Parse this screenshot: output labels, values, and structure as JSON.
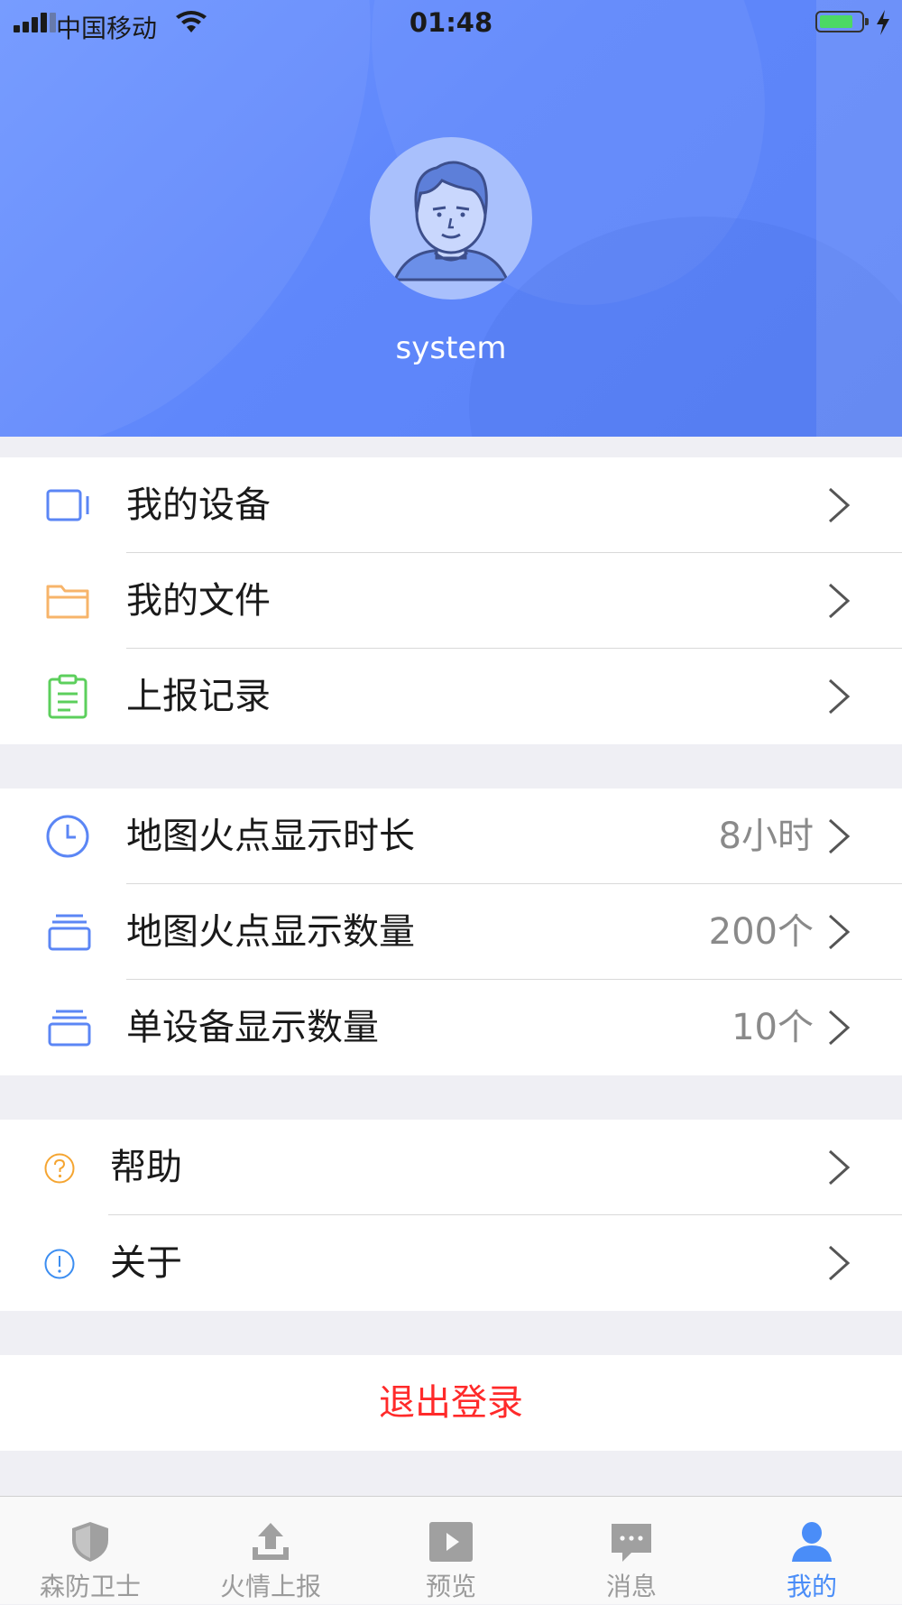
{
  "status_bar": {
    "carrier": "中国移动",
    "time": "01:48"
  },
  "profile": {
    "username": "system"
  },
  "groups": [
    {
      "items": [
        {
          "label": "我的设备",
          "icon": "device-icon",
          "color": "#5b86f5"
        },
        {
          "label": "我的文件",
          "icon": "folder-icon",
          "color": "#f7b46a"
        },
        {
          "label": "上报记录",
          "icon": "clipboard-icon",
          "color": "#5ccf5c"
        }
      ]
    },
    {
      "items": [
        {
          "label": "地图火点显示时长",
          "value": "8小时",
          "icon": "clock-icon",
          "color": "#5b86f5"
        },
        {
          "label": "地图火点显示数量",
          "value": "200个",
          "icon": "stack-icon",
          "color": "#5b86f5"
        },
        {
          "label": "单设备显示数量",
          "value": "10个",
          "icon": "stack-icon",
          "color": "#5b86f5"
        }
      ]
    },
    {
      "items": [
        {
          "label": "帮助",
          "icon": "question-icon",
          "color": "#f5a531"
        },
        {
          "label": "关于",
          "icon": "info-icon",
          "color": "#3b8df1"
        }
      ]
    }
  ],
  "logout": {
    "label": "退出登录",
    "color": "#ff2a2a"
  },
  "tabs": [
    {
      "label": "森防卫士",
      "icon": "shield-icon",
      "active": false
    },
    {
      "label": "火情上报",
      "icon": "upload-icon",
      "active": false
    },
    {
      "label": "预览",
      "icon": "play-icon",
      "active": false
    },
    {
      "label": "消息",
      "icon": "message-icon",
      "active": false
    },
    {
      "label": "我的",
      "icon": "user-icon",
      "active": true
    }
  ],
  "colors": {
    "header": "#6189fa",
    "tab_active": "#4a8df8",
    "tab_inactive": "#9b9b9b"
  }
}
